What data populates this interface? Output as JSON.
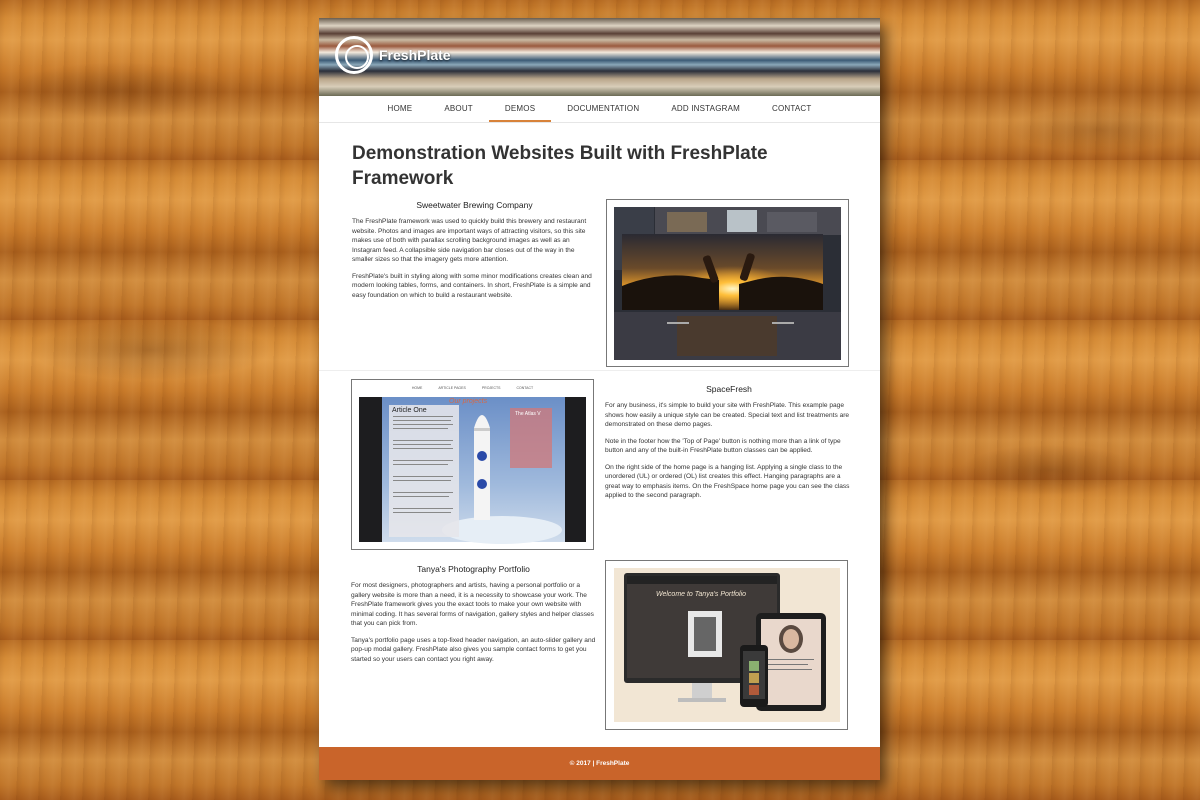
{
  "site": {
    "logo_text": "FreshPlate"
  },
  "nav": {
    "items": [
      {
        "label": "HOME"
      },
      {
        "label": "ABOUT"
      },
      {
        "label": "DEMOS"
      },
      {
        "label": "DOCUMENTATION"
      },
      {
        "label": "ADD INSTAGRAM"
      },
      {
        "label": "CONTACT"
      }
    ],
    "active": "DEMOS",
    "accent": "#d8823a"
  },
  "main": {
    "title": "Demonstration Websites Built with FreshPlate Framework",
    "sections": [
      {
        "heading": "Sweetwater Brewing Company",
        "paragraphs": [
          "The FreshPlate framework was used to quickly build this brewery and restaurant website. Photos and images are important ways of attracting visitors, so this site makes use of both with parallax scrolling background images as well as an Instagram feed. A collapsible side navigation bar closes out of the way in the smaller sizes so that the imagery gets more attention.",
          "FreshPlate's built in styling along with some minor modifications creates clean and modern looking tables, forms, and containers. In short, FreshPlate is a simple and easy foundation on which to build a restaurant website."
        ]
      },
      {
        "heading": "SpaceFresh",
        "paragraphs": [
          "For any business, it's simple to build your site with FreshPlate. This example page shows how easily a unique style can be created. Special text and list treatments are demonstrated on these demo pages.",
          "Note in the footer how the 'Top of Page' button is nothing more than a link of type button and any of the built-in FreshPlate button classes can be applied.",
          "On the right side of the home page is a hanging list. Applying a single class to the unordered (UL) or ordered (OL) list creates this effect. Hanging paragraphs are a great way to emphasis items. On the FreshSpace home page you can see the class applied to the second paragraph."
        ]
      },
      {
        "heading": "Tanya's Photography Portfolio",
        "paragraphs": [
          "For most designers, photographers and artists, having a personal portfolio or a gallery website is more than a need, it is a necessity to showcase your work. The FreshPlate framework gives you the exact tools to make your own website with minimal coding. It has several forms of navigation, gallery styles and helper classes that you can pick from.",
          "Tanya's portfolio page uses a top-fixed header navigation, an auto-slider gallery and pop-up modal gallery. FreshPlate also gives you sample contact forms to get you started so your users can contact you right away."
        ]
      }
    ]
  },
  "thumbnails": {
    "space": {
      "nav_items": [
        "HOME",
        "ARTICLE PAGES",
        "PROJECTS",
        "CONTACT"
      ],
      "banner_text": "Our projects",
      "article_title": "Article One",
      "side_title": "The Atlas V"
    },
    "tanya": {
      "welcome": "Welcome to Tanya's Portfolio"
    }
  },
  "footer": {
    "text": "© 2017 | FreshPlate",
    "color": "#c9642a"
  }
}
